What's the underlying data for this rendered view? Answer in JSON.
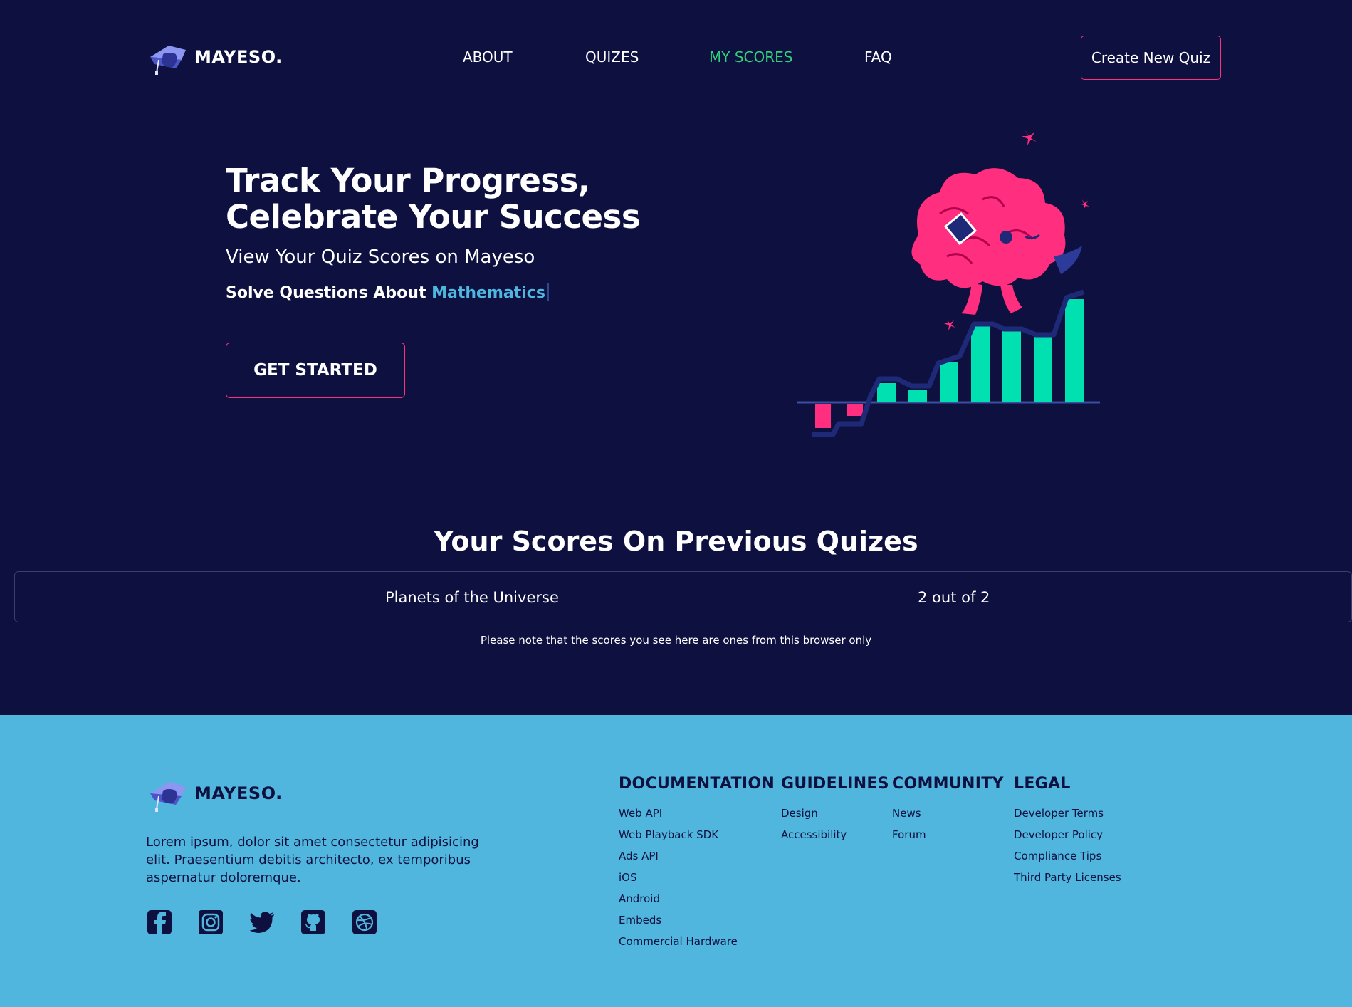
{
  "brand": {
    "name": "MAYESO."
  },
  "nav": {
    "links": [
      {
        "label": "ABOUT",
        "active": false
      },
      {
        "label": "QUIZES",
        "active": false
      },
      {
        "label": "MY SCORES",
        "active": true
      },
      {
        "label": "FAQ",
        "active": false
      }
    ],
    "cta": "Create New Quiz"
  },
  "hero": {
    "title": "Track Your Progress, Celebrate Your Success",
    "subtitle": "View Your Quiz Scores on Mayeso",
    "topic_prefix": "Solve Questions About ",
    "topic_value": "Mathematics",
    "button": "GET STARTED"
  },
  "scores": {
    "title": "Your Scores On Previous Quizes",
    "rows": [
      {
        "quiz": "Planets of the Universe",
        "score": "2 out of 2"
      }
    ],
    "note": "Please note that the scores you see here are ones from this browser only"
  },
  "footer": {
    "description": "Lorem ipsum, dolor sit amet consectetur adipisicing elit. Praesentium debitis architecto, ex temporibus aspernatur doloremque.",
    "socials": [
      "facebook-icon",
      "instagram-icon",
      "twitter-icon",
      "github-icon",
      "dribbble-icon"
    ],
    "columns": [
      {
        "title": "DOCUMENTATION",
        "links": [
          "Web API",
          "Web Playback SDK",
          "Ads API",
          "iOS",
          "Android",
          "Embeds",
          "Commercial Hardware"
        ]
      },
      {
        "title": "GUIDELINES",
        "links": [
          "Design",
          "Accessibility"
        ]
      },
      {
        "title": "COMMUNITY",
        "links": [
          "News",
          "Forum"
        ]
      },
      {
        "title": "LEGAL",
        "links": [
          "Developer Terms",
          "Developer Policy",
          "Compliance Tips",
          "Third Party Licenses"
        ]
      }
    ]
  },
  "colors": {
    "background": "#0e1040",
    "accent_pink": "#ff2e7e",
    "accent_green": "#2fd47a",
    "accent_blue": "#4fb6e0",
    "footer_bg": "#50b6de",
    "bar_teal": "#00e0b0"
  }
}
